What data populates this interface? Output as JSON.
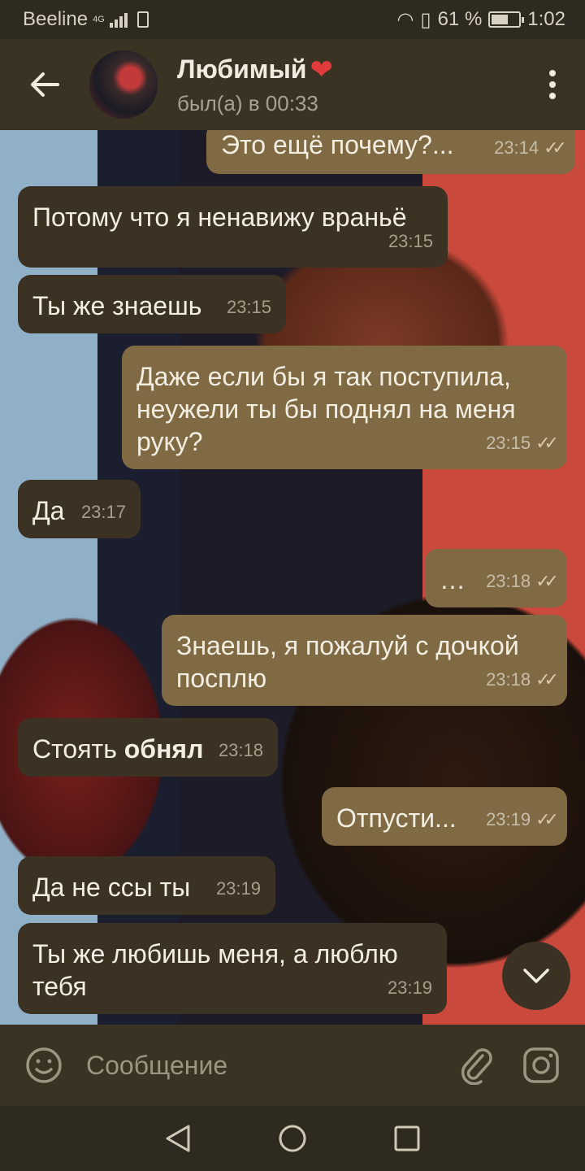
{
  "status": {
    "carrier": "Beeline",
    "net": "4G",
    "battery": "61 %",
    "time": "1:02",
    "battery_level": 0.61
  },
  "header": {
    "back_icon": "arrow-left-icon",
    "name": "Любимый",
    "name_emoji": "❤",
    "last_seen": "был(а) в 00:33",
    "menu_icon": "more-vertical-icon"
  },
  "messages": [
    {
      "dir": "out",
      "text": "Это ещё почему?...",
      "time": "23:14",
      "read": "✓✓"
    },
    {
      "dir": "in",
      "text": "Потому что я ненавижу враньё",
      "time": "23:15"
    },
    {
      "dir": "in",
      "text": "Ты же знаешь",
      "time": "23:15"
    },
    {
      "dir": "out",
      "text": "Даже если бы я так поступила, неужели ты бы поднял на меня руку?",
      "time": "23:15",
      "read": "✓✓"
    },
    {
      "dir": "in",
      "text": "Да",
      "time": "23:17"
    },
    {
      "dir": "out",
      "text": "…",
      "time": "23:18",
      "read": "✓✓"
    },
    {
      "dir": "out",
      "text": "Знаешь, я пожалуй с дочкой посплю",
      "time": "23:18",
      "read": "✓✓"
    },
    {
      "dir": "in",
      "text": "Стоять ",
      "text_bold": "обнял",
      "time": "23:18"
    },
    {
      "dir": "out",
      "text": "Отпусти...",
      "time": "23:19",
      "read": "✓✓"
    },
    {
      "dir": "in",
      "text": "Да не ссы ты",
      "time": "23:19"
    },
    {
      "dir": "in",
      "text": "Ты же любишь меня, а люблю тебя",
      "time": "23:19"
    }
  ],
  "composer": {
    "placeholder": "Сообщение",
    "emoji_icon": "smile-icon",
    "attach_icon": "paperclip-icon",
    "camera_icon": "camera-icon"
  },
  "colors": {
    "header_bg": "#3a3323",
    "incoming_bubble": "#3b3224",
    "outgoing_bubble": "#806a44",
    "heart": "#e23b3b"
  }
}
